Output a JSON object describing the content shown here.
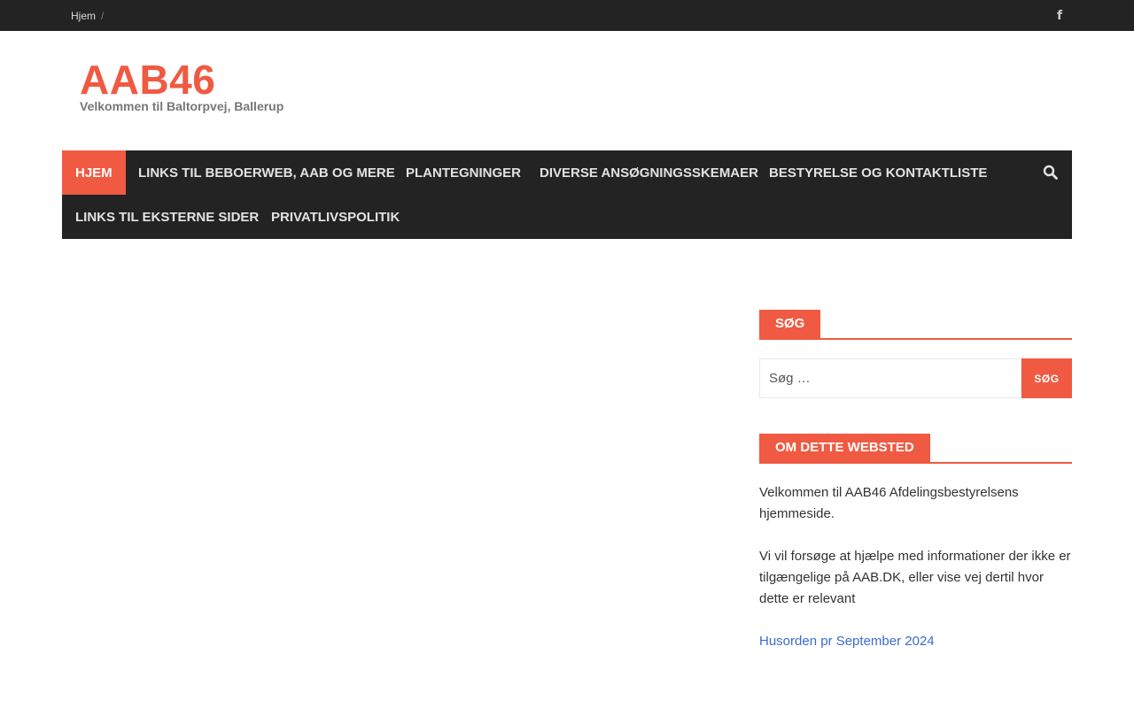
{
  "topbar": {
    "breadcrumb": {
      "home": "Hjem",
      "separator": "/"
    },
    "social": {
      "icon": "facebook-icon",
      "glyph": "f"
    }
  },
  "header": {
    "title": "AAB46",
    "description": "Velkommen til Baltorpvej, Ballerup"
  },
  "nav": {
    "items": [
      {
        "label": "Hjem",
        "active": true
      },
      {
        "label": "Links til Beboerweb, AAB og mere"
      },
      {
        "label": "Plantegninger"
      },
      {
        "label": "Diverse ansøgningsskemaer"
      },
      {
        "label": "Bestyrelse og kontaktliste"
      },
      {
        "label": "Links til eksterne sider"
      },
      {
        "label": "Privatlivspolitik"
      }
    ],
    "search_icon": "search-icon"
  },
  "sidebar": {
    "search_widget": {
      "title": "Søg",
      "placeholder": "Søg …",
      "button": "SØG"
    },
    "about_widget": {
      "title": "Om dette websted",
      "paragraph_1": "Velkommen til AAB46 Afdelingsbestyrelsens hjemmeside.",
      "paragraph_2": "Vi vil forsøge at hjælpe med informationer der ikke er tilgængelige på AAB.DK, eller vise vej dertil hvor dette er relevant",
      "link": "Husorden pr September 2024"
    }
  },
  "colors": {
    "accent": "#f05a42",
    "dark": "#232323",
    "link": "#3a6bd1"
  }
}
